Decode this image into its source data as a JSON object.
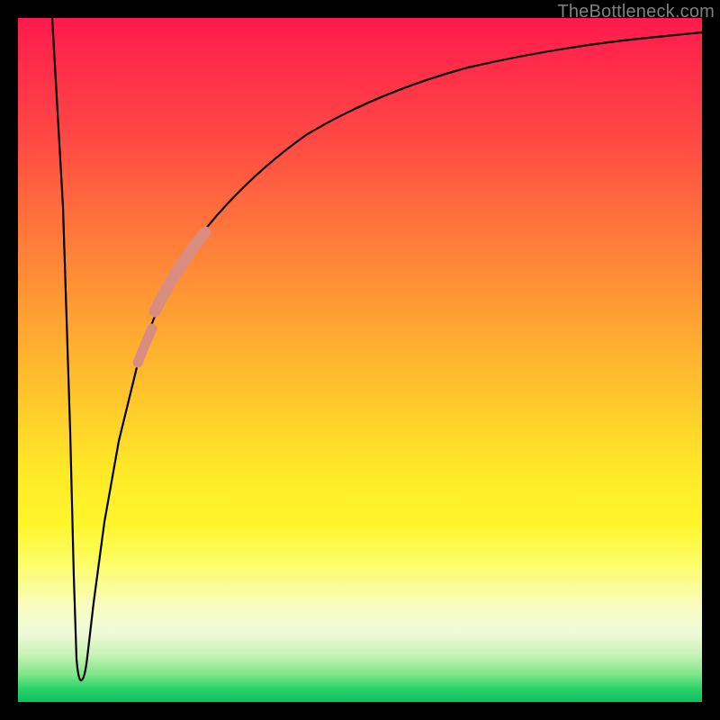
{
  "watermark": "TheBottleneck.com",
  "chart_data": {
    "type": "line",
    "title": "",
    "xlabel": "",
    "ylabel": "",
    "xlim": [
      0,
      100
    ],
    "ylim": [
      0,
      100
    ],
    "grid": false,
    "legend": false,
    "series": [
      {
        "name": "bottleneck-curve",
        "color": "#000000",
        "x": [
          5,
          6,
          7,
          8,
          9,
          10,
          12,
          15,
          18,
          22,
          26,
          30,
          35,
          40,
          45,
          50,
          55,
          60,
          65,
          70,
          75,
          80,
          85,
          90,
          95,
          100
        ],
        "y": [
          100,
          60,
          20,
          4,
          3,
          6,
          20,
          38,
          50,
          60,
          68,
          74,
          79,
          83,
          86,
          88.5,
          90.5,
          92,
          93.2,
          94.2,
          95,
          95.7,
          96.2,
          96.7,
          97.1,
          97.5
        ]
      }
    ],
    "highlight_segments": [
      {
        "name": "highlight-upper",
        "color": "#d98c80",
        "width": 11,
        "x_range": [
          20,
          26
        ],
        "y_range": [
          55,
          68
        ]
      },
      {
        "name": "highlight-lower",
        "color": "#d98c80",
        "width": 9,
        "x_range": [
          17,
          19.5
        ],
        "y_range": [
          48,
          54
        ]
      }
    ],
    "minimum_at": {
      "x": 8.5,
      "y": 3
    }
  }
}
